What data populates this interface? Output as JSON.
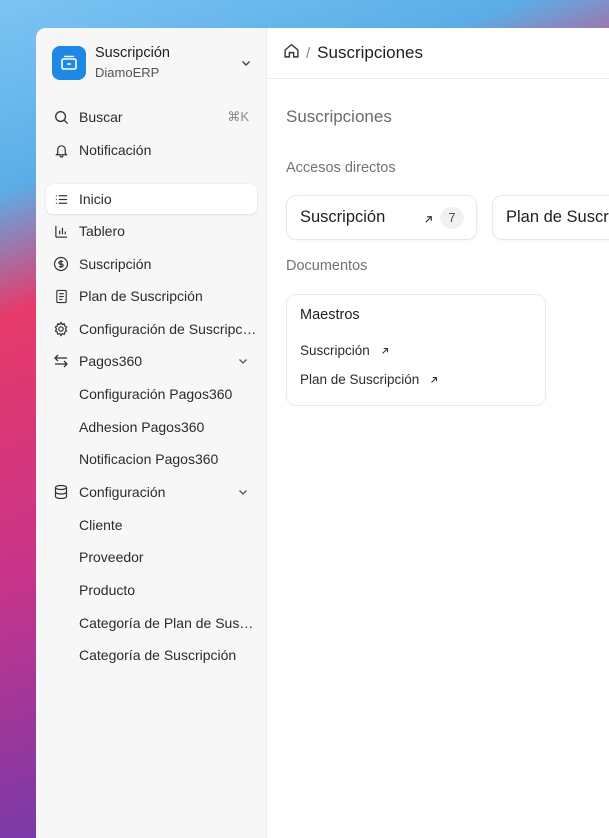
{
  "app": {
    "name": "Suscripción",
    "company": "DiamoERP",
    "logo_color": "#1e88e5"
  },
  "sidebar": {
    "search": {
      "label": "Buscar",
      "shortcut": "⌘K"
    },
    "notifications": {
      "label": "Notificación"
    },
    "items": [
      {
        "label": "Inicio",
        "icon": "list-icon",
        "active": true
      },
      {
        "label": "Tablero",
        "icon": "bar-chart-icon"
      },
      {
        "label": "Suscripción",
        "icon": "dollar-circle-icon"
      },
      {
        "label": "Plan de Suscripción",
        "icon": "document-icon"
      },
      {
        "label": "Configuración de Suscripción",
        "icon": "gear-icon"
      },
      {
        "label": "Pagos360",
        "icon": "arrows-exchange-icon",
        "expanded": true
      },
      {
        "label": "Configuración Pagos360"
      },
      {
        "label": "Adhesion Pagos360"
      },
      {
        "label": "Notificacion Pagos360"
      },
      {
        "label": "Configuración",
        "icon": "database-icon",
        "expanded": true
      },
      {
        "label": "Cliente"
      },
      {
        "label": "Proveedor"
      },
      {
        "label": "Producto"
      },
      {
        "label": "Categoría de Plan de Suscripción"
      },
      {
        "label": "Categoría de Suscripción"
      }
    ]
  },
  "header": {
    "breadcrumb_current": "Suscripciones",
    "breadcrumb_sep": "/"
  },
  "main": {
    "page_title": "Suscripciones",
    "shortcuts_title": "Accesos directos",
    "shortcuts": [
      {
        "label": "Suscripción",
        "count": "7"
      },
      {
        "label": "Plan de Suscripción"
      }
    ],
    "documents_title": "Documentos",
    "documents": {
      "card_title": "Maestros",
      "links": [
        "Suscripción",
        "Plan de Suscripción"
      ]
    }
  }
}
